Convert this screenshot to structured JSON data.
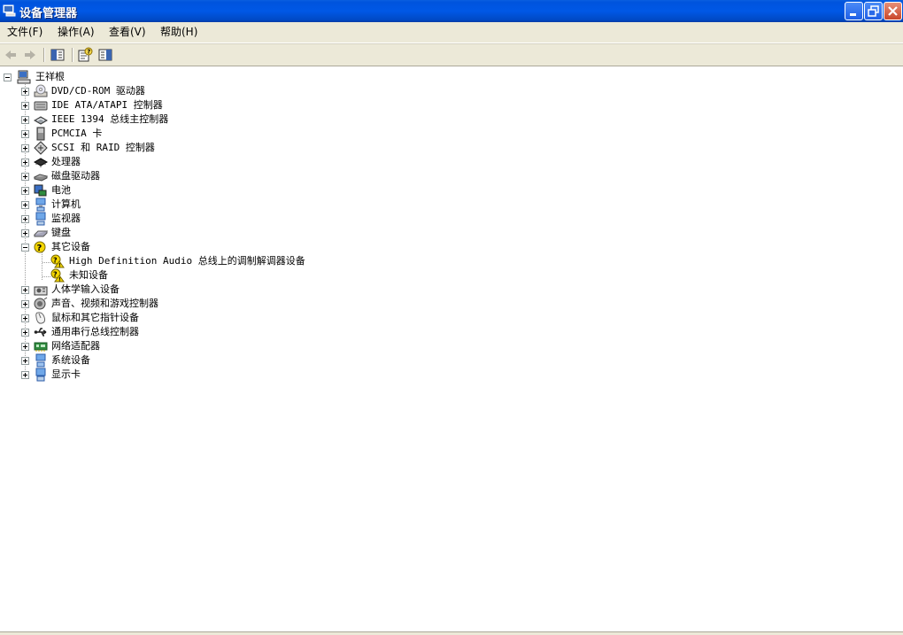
{
  "window": {
    "title": "设备管理器"
  },
  "colors": {
    "title_bar": "#0058e6",
    "menu_bg": "#ece9d8",
    "tree_bg": "#ffffff",
    "warning": "#f4d600"
  },
  "menu": [
    {
      "label": "文件(F)"
    },
    {
      "label": "操作(A)"
    },
    {
      "label": "查看(V)"
    },
    {
      "label": "帮助(H)"
    }
  ],
  "toolbar": {
    "buttons": [
      {
        "icon": "back-arrow-icon"
      },
      {
        "icon": "forward-arrow-icon"
      },
      {
        "icon": "show-hide-tree-icon"
      },
      {
        "icon": "properties-icon"
      },
      {
        "icon": "update-driver-icon"
      }
    ]
  },
  "tree": {
    "root": {
      "label": "王祥根",
      "icon": "computer-icon",
      "expanded": true
    },
    "categories": [
      {
        "label": "DVD/CD-ROM 驱动器",
        "icon": "cdrom-icon",
        "expanded": false
      },
      {
        "label": "IDE ATA/ATAPI 控制器",
        "icon": "ide-controller-icon",
        "expanded": false
      },
      {
        "label": "IEEE 1394 总线主控制器",
        "icon": "ieee1394-icon",
        "expanded": false
      },
      {
        "label": "PCMCIA 卡",
        "icon": "pcmcia-icon",
        "expanded": false
      },
      {
        "label": "SCSI 和 RAID 控制器",
        "icon": "scsi-icon",
        "expanded": false
      },
      {
        "label": "处理器",
        "icon": "processor-icon",
        "expanded": false
      },
      {
        "label": "磁盘驱动器",
        "icon": "disk-drive-icon",
        "expanded": false
      },
      {
        "label": "电池",
        "icon": "battery-icon",
        "expanded": false
      },
      {
        "label": "计算机",
        "icon": "computer-icon",
        "expanded": false
      },
      {
        "label": "监视器",
        "icon": "monitor-icon",
        "expanded": false
      },
      {
        "label": "键盘",
        "icon": "keyboard-icon",
        "expanded": false
      },
      {
        "label": "其它设备",
        "icon": "other-devices-icon",
        "expanded": true,
        "children": [
          {
            "label": "High Definition Audio 总线上的调制解调器设备",
            "icon": "warning-device-icon"
          },
          {
            "label": "未知设备",
            "icon": "warning-device-icon"
          }
        ]
      },
      {
        "label": "人体学输入设备",
        "icon": "hid-icon",
        "expanded": false
      },
      {
        "label": "声音、视频和游戏控制器",
        "icon": "sound-icon",
        "expanded": false
      },
      {
        "label": "鼠标和其它指针设备",
        "icon": "mouse-icon",
        "expanded": false
      },
      {
        "label": "通用串行总线控制器",
        "icon": "usb-icon",
        "expanded": false
      },
      {
        "label": "网络适配器",
        "icon": "network-adapter-icon",
        "expanded": false
      },
      {
        "label": "系统设备",
        "icon": "system-device-icon",
        "expanded": false
      },
      {
        "label": "显示卡",
        "icon": "display-adapter-icon",
        "expanded": false
      }
    ]
  }
}
